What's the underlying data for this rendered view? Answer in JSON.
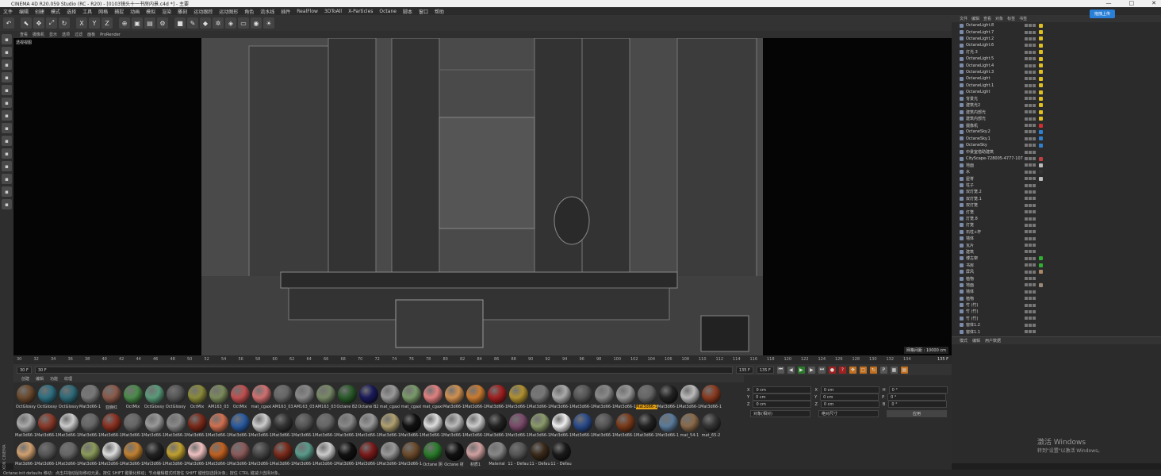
{
  "window": {
    "title": "CINEMA 4D R20.059 Studio (RC - R20) - [0103镜头十一书房内景.c4d *] - 主要",
    "controls": [
      "—",
      "□",
      "✕"
    ]
  },
  "menu": [
    "文件",
    "编辑",
    "创建",
    "模式",
    "选择",
    "工具",
    "网格",
    "捕捉",
    "动画",
    "模拟",
    "渲染",
    "雕刻",
    "运动跟踪",
    "运动图形",
    "角色",
    "流水线",
    "插件",
    "RealFlow",
    "3DToAll",
    "X-Particles",
    "Octane",
    "脚本",
    "窗口",
    "帮助"
  ],
  "toolbar_icons": [
    "undo-icon",
    "select-icon",
    "move-icon",
    "scale-icon",
    "rotate-icon",
    "axis-x-icon",
    "axis-y-icon",
    "axis-z-icon",
    "world-icon",
    "render-icon",
    "render-view-icon",
    "render-settings-icon",
    "cube-icon",
    "pen-icon",
    "subdivide-icon",
    "array-icon",
    "deformer-icon",
    "floor-icon",
    "camera-icon",
    "light-icon"
  ],
  "viewport": {
    "menu": [
      "查看",
      "摄像机",
      "显示",
      "选项",
      "过滤",
      "面板",
      "ProRender"
    ],
    "label": "透视视图",
    "grid_distance": "网格间距 : 10000 cm"
  },
  "timeline": {
    "ticks": [
      "30",
      "32",
      "34",
      "36",
      "38",
      "40",
      "42",
      "44",
      "46",
      "48",
      "50",
      "52",
      "54",
      "56",
      "58",
      "60",
      "62",
      "64",
      "66",
      "68",
      "70",
      "72",
      "74",
      "76",
      "78",
      "80",
      "82",
      "84",
      "86",
      "88",
      "90",
      "92",
      "94",
      "96",
      "98",
      "100",
      "102",
      "104",
      "106",
      "108",
      "110",
      "112",
      "114",
      "116",
      "118",
      "120",
      "122",
      "124",
      "126",
      "128",
      "130",
      "132",
      "134"
    ],
    "end": "135 F"
  },
  "playback": {
    "start": "30 F",
    "current": "30 F",
    "end_field": "135 F",
    "end_field2": "135 F"
  },
  "materials": {
    "tabs": [
      "创建",
      "编辑",
      "功能",
      "纹理"
    ],
    "items": [
      {
        "name": "OctGlossy",
        "color": "#6b4a2e"
      },
      {
        "name": "OctGlossy",
        "color": "#2e6e80"
      },
      {
        "name": "OctGlossy",
        "color": "#2e6a78"
      },
      {
        "name": "Mat3d66-1",
        "color": "#777"
      },
      {
        "name": "亚麻红",
        "color": "#8a5a4a"
      },
      {
        "name": "OctMix",
        "color": "#4a8a4a"
      },
      {
        "name": "OctGlossy",
        "color": "#5a9a7a"
      },
      {
        "name": "OctGlossy",
        "color": "#555"
      },
      {
        "name": "OctMix",
        "color": "#8a8a3a"
      },
      {
        "name": "AM163_03",
        "color": "#7a8a5a"
      },
      {
        "name": "OctMix",
        "color": "#c05050"
      },
      {
        "name": "mat_cgaxi",
        "color": "#d07070"
      },
      {
        "name": "AM163_03",
        "color": "#666"
      },
      {
        "name": "AM163_03",
        "color": "#888"
      },
      {
        "name": "AM163_03",
        "color": "#778866"
      },
      {
        "name": "Octane B2",
        "color": "#2a5a2a"
      },
      {
        "name": "Octane B2",
        "color": "#1a1a5a"
      },
      {
        "name": "mat_cgaxi",
        "color": "#999"
      },
      {
        "name": "mat_cgaxi",
        "color": "#7a9a6a"
      },
      {
        "name": "mat_cgaxi",
        "color": "#e08080"
      },
      {
        "name": "Mat3d66-1",
        "color": "#d09050"
      },
      {
        "name": "Mat3d66-1",
        "color": "#c87a30"
      },
      {
        "name": "Mat3d66-1",
        "color": "#a02020"
      },
      {
        "name": "Mat3d66-1",
        "color": "#b09030"
      },
      {
        "name": "Mat3d66-1",
        "color": "#777"
      },
      {
        "name": "Mat3d66-1",
        "color": "#aaa"
      },
      {
        "name": "Mat3d66-1",
        "color": "#555"
      },
      {
        "name": "Mat3d66-1",
        "color": "#888"
      },
      {
        "name": "Mat3d66-1",
        "color": "#999"
      },
      {
        "name": "Mat3d66-1",
        "color": "#666"
      },
      {
        "name": "Mat3d66-1",
        "color": "#222"
      },
      {
        "name": "Mat3d66-1",
        "color": "#bbb"
      },
      {
        "name": "Mat3d66-1",
        "color": "#8a3a20"
      },
      {
        "name": "Mat3d66-1",
        "color": "#aaa"
      },
      {
        "name": "Mat3d66-1",
        "color": "#8a3a2a"
      },
      {
        "name": "Mat3d66-1",
        "color": "#ccc"
      },
      {
        "name": "Mat3d66-1",
        "color": "#666"
      },
      {
        "name": "Mat3d66-1",
        "color": "#8a3020"
      },
      {
        "name": "Mat3d66-1",
        "color": "#666"
      },
      {
        "name": "Mat3d66-1",
        "color": "#999"
      },
      {
        "name": "Mat3d66-1",
        "color": "#888"
      },
      {
        "name": "Mat3d66-1",
        "color": "#7a2a1a"
      },
      {
        "name": "Mat3d66-1",
        "color": "#d07050"
      },
      {
        "name": "Mat3d66-1",
        "color": "#2a5aa0"
      },
      {
        "name": "Mat3d66-1",
        "color": "#ccc"
      },
      {
        "name": "Mat3d66-1",
        "color": "#333"
      },
      {
        "name": "Mat3d66-1",
        "color": "#555"
      },
      {
        "name": "Mat3d66-1",
        "color": "#666"
      },
      {
        "name": "Mat3d66-1",
        "color": "#888"
      },
      {
        "name": "Mat3d66-1",
        "color": "#999"
      },
      {
        "name": "Mat3d66-1",
        "color": "#b0a070"
      },
      {
        "name": "Mat3d66-1",
        "color": "#111"
      },
      {
        "name": "Mat3d66-1",
        "color": "#ddd"
      },
      {
        "name": "Mat3d66-1",
        "color": "#bbb"
      },
      {
        "name": "Mat3d66-1",
        "color": "#ccc"
      },
      {
        "name": "Mat3d66-1",
        "color": "#222"
      },
      {
        "name": "Mat3d66-1",
        "color": "#7a4a6a"
      },
      {
        "name": "Mat3d66-1",
        "color": "#8a9a6a"
      },
      {
        "name": "Mat3d66-1",
        "color": "#eee"
      },
      {
        "name": "Mat3d66-1",
        "color": "#2a4a8a"
      },
      {
        "name": "Mat3d66-1",
        "color": "#555"
      },
      {
        "name": "Mat3d66-1",
        "color": "#7a3a1a"
      },
      {
        "name": "Mat3d66-1",
        "color": "#222"
      },
      {
        "name": "Mat3d66-1",
        "color": "#5a7a9a"
      },
      {
        "name": "mat_54-1",
        "color": "#8a6a4a"
      },
      {
        "name": "mat_65-2",
        "color": "#333"
      },
      {
        "name": "Mat3d66-1",
        "color": "#d0a070"
      },
      {
        "name": "Mat3d66-1",
        "color": "#555"
      },
      {
        "name": "Mat3d66-1",
        "color": "#666"
      },
      {
        "name": "Mat3d66-1",
        "color": "#8a9a5a"
      },
      {
        "name": "Mat3d66-1",
        "color": "#ddd"
      },
      {
        "name": "Mat3d66-1",
        "color": "#c08030"
      },
      {
        "name": "Mat3d66-1",
        "color": "#222"
      },
      {
        "name": "Mat3d66-1",
        "color": "#c0a030"
      },
      {
        "name": "Mat3d66-1",
        "color": "#f0c0c0"
      },
      {
        "name": "Mat3d66-1",
        "color": "#c06020"
      },
      {
        "name": "Mat3d66-1",
        "color": "#8a5a5a"
      },
      {
        "name": "Mat3d66-1",
        "color": "#444"
      },
      {
        "name": "Mat3d66-1",
        "color": "#7a2a1a"
      },
      {
        "name": "Mat3d66-1",
        "color": "#5a9a8a"
      },
      {
        "name": "Mat3d66-1",
        "color": "#ccc"
      },
      {
        "name": "Mat3d66-1",
        "color": "#111"
      },
      {
        "name": "Mat3d66-1",
        "color": "#7a1a1a"
      },
      {
        "name": "Mat3d66-1",
        "color": "#999"
      },
      {
        "name": "Mat3d66-1",
        "color": "#6a4a2a"
      },
      {
        "name": "Octane 阴",
        "color": "#2a7a2a"
      },
      {
        "name": "Octane 材",
        "color": "#111"
      },
      {
        "name": "材质1",
        "color": "#d0a0a0"
      },
      {
        "name": "Material",
        "color": "#888"
      },
      {
        "name": "11 - Defau",
        "color": "#555"
      },
      {
        "name": "11 - Defau",
        "color": "#3a2a1a"
      },
      {
        "name": "11 - Defau",
        "color": "#1a1a1a"
      }
    ],
    "selected_index": 29
  },
  "coords": {
    "rows": [
      {
        "a": "X",
        "av": "0 cm",
        "b": "X",
        "bv": "0 cm",
        "c": "H",
        "cv": "0 °"
      },
      {
        "a": "Y",
        "av": "0 cm",
        "b": "Y",
        "bv": "0 cm",
        "c": "P",
        "cv": "0 °"
      },
      {
        "a": "Z",
        "av": "0 cm",
        "b": "Z",
        "bv": "0 cm",
        "c": "B",
        "cv": "0 °"
      }
    ],
    "mode1": "对象(相对)",
    "mode2": "绝对尺寸",
    "apply": "应用"
  },
  "object_manager": {
    "tabs": [
      "文件",
      "编辑",
      "查看",
      "对象",
      "标签",
      "书签"
    ],
    "rows": [
      {
        "name": "OctaneLight.8",
        "tag": "#e0c020"
      },
      {
        "name": "OctaneLight.7",
        "tag": "#e0c020"
      },
      {
        "name": "OctaneLight.2",
        "tag": "#e0c020"
      },
      {
        "name": "OctaneLight.6",
        "tag": "#e0c020"
      },
      {
        "name": "灯光.3",
        "tag": "#e0c020"
      },
      {
        "name": "OctaneLight.5",
        "tag": "#e0c020"
      },
      {
        "name": "OctaneLight.4",
        "tag": "#e0c020"
      },
      {
        "name": "OctaneLight.3",
        "tag": "#e0c020"
      },
      {
        "name": "OctaneLight",
        "tag": "#e0c020"
      },
      {
        "name": "OctaneLight.1",
        "tag": "#e0c020"
      },
      {
        "name": "OctaneLight",
        "tag": "#e0c020"
      },
      {
        "name": "背景光",
        "tag": "#e0c020"
      },
      {
        "name": "建筑光2",
        "tag": "#e0c020"
      },
      {
        "name": "建筑内部光",
        "tag": "#e0c020"
      },
      {
        "name": "建筑内部光",
        "tag": "#e0c020"
      },
      {
        "name": "摄像机",
        "tag": "#d03030"
      },
      {
        "name": "OctaneSky.2",
        "tag": "#3080d0"
      },
      {
        "name": "OctaneSky.1",
        "tag": "#3080d0"
      },
      {
        "name": "OctaneSky",
        "tag": "#3080d0"
      },
      {
        "name": "中景室借助建筑",
        "tag": ""
      },
      {
        "name": "CityScape-728005-4777-107",
        "tag": "#c04040"
      },
      {
        "name": "地面",
        "tag": "#bbbbbb"
      },
      {
        "name": "水",
        "tag": "#333"
      },
      {
        "name": "屋脊",
        "tag": "#bbbbbb"
      },
      {
        "name": "柱子",
        "tag": ""
      },
      {
        "name": "双灯笼.2",
        "tag": ""
      },
      {
        "name": "双灯笼.1",
        "tag": ""
      },
      {
        "name": "双灯笼",
        "tag": ""
      },
      {
        "name": "灯笼",
        "tag": ""
      },
      {
        "name": "灯笼.8",
        "tag": ""
      },
      {
        "name": "灯笼",
        "tag": ""
      },
      {
        "name": "石柱+杆",
        "tag": ""
      },
      {
        "name": "墙体",
        "tag": ""
      },
      {
        "name": "瓦片",
        "tag": ""
      },
      {
        "name": "建筑",
        "tag": ""
      },
      {
        "name": "博古架",
        "tag": "#30b030"
      },
      {
        "name": "书房",
        "tag": "#30b030"
      },
      {
        "name": "屏风",
        "tag": "#aa8866"
      },
      {
        "name": "植物",
        "tag": ""
      },
      {
        "name": "地面",
        "tag": "#998877"
      },
      {
        "name": "墙体",
        "tag": ""
      },
      {
        "name": "植物",
        "tag": ""
      },
      {
        "name": "竹 (竹)",
        "tag": ""
      },
      {
        "name": "竹 (竹)",
        "tag": ""
      },
      {
        "name": "竹 (竹)",
        "tag": ""
      },
      {
        "name": "窗体1.2",
        "tag": ""
      },
      {
        "name": "窗体1.1",
        "tag": ""
      }
    ],
    "upload_label": "拖拽上传"
  },
  "attributes": {
    "tabs": [
      "模式",
      "编辑",
      "用户数据"
    ]
  },
  "status_text": "Octane:init defaults   移动：点击并拖动鼠标移动元素。按住 SHIFT 键量化移动；节点编辑模式时按住 SHIFT 键增加选择对象；按住 CTRL 键减少选择对象。",
  "watermark": {
    "line1": "激活 Windows",
    "line2": "转到\"设置\"以激活 Windows。"
  },
  "side_vertical_text": "MAXON CINEMA 4D"
}
